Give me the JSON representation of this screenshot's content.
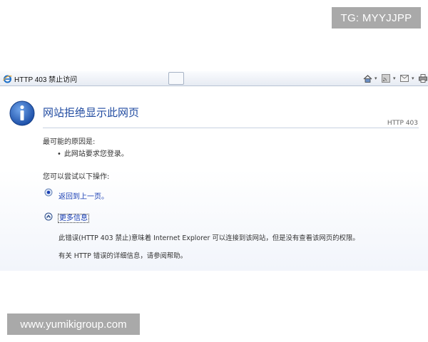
{
  "watermarks": {
    "top_right": "TG: MYYJJPP",
    "bottom_left": "www.yumikigroup.com"
  },
  "browser": {
    "tab_title": "HTTP 403 禁止访问",
    "toolbar_icons": [
      "home-icon",
      "rss-icon",
      "mail-icon",
      "print-icon"
    ]
  },
  "page": {
    "title": "网站拒绝显示此网页",
    "http_code": "HTTP 403",
    "causes_heading": "最可能的原因是:",
    "causes": [
      "此网站要求您登录。"
    ],
    "actions_heading": "您可以尝试以下操作:",
    "back_link": "返回到上一页。",
    "more_info_link": "更多信息",
    "detail_1": "此错误(HTTP 403 禁止)意味着 Internet Explorer 可以连接到该网站，但是没有查看该网页的权限。",
    "detail_2": "有关 HTTP 错误的详细信息，请参阅帮助。"
  },
  "colors": {
    "title_blue": "#1f4aa0",
    "link_blue": "#1a3fb4",
    "watermark_bg": "#a9a9a9"
  }
}
